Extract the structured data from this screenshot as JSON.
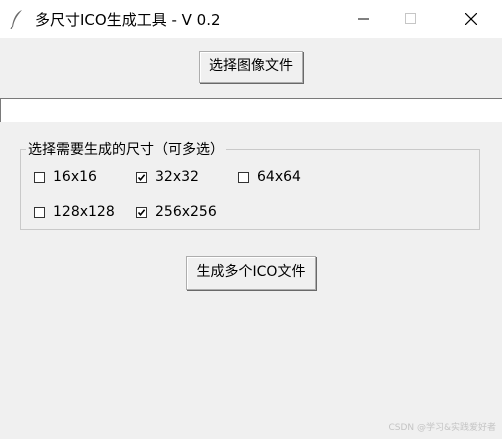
{
  "window": {
    "title": "多尺寸ICO生成工具 - V 0.2",
    "icon": "feather-icon"
  },
  "toolbar": {
    "choose_label": "选择图像文件",
    "generate_label": "生成多个ICO文件"
  },
  "path_entry": {
    "value": ""
  },
  "sizes_group": {
    "label": "选择需要生成的尺寸（可多选）",
    "options": [
      {
        "label": "16x16",
        "checked": false
      },
      {
        "label": "32x32",
        "checked": true
      },
      {
        "label": "64x64",
        "checked": false
      },
      {
        "label": "128x128",
        "checked": false
      },
      {
        "label": "256x256",
        "checked": true
      }
    ]
  },
  "watermark": "CSDN @学习&实践爱好者"
}
